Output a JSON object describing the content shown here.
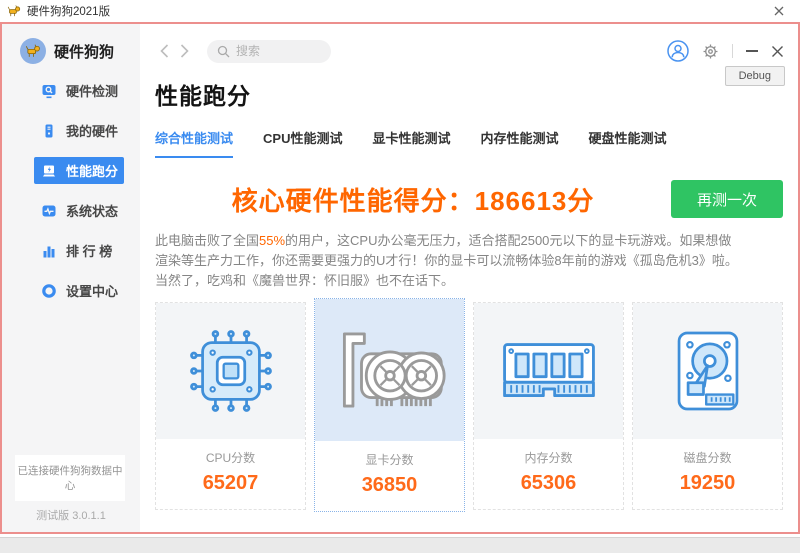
{
  "window": {
    "title": "硬件狗狗2021版"
  },
  "sidebar": {
    "app_name": "硬件狗狗",
    "items": [
      {
        "label": "硬件检测",
        "icon": "monitor-search-icon"
      },
      {
        "label": "我的硬件",
        "icon": "pc-tower-icon"
      },
      {
        "label": "性能跑分",
        "icon": "laptop-bolt-icon"
      },
      {
        "label": "系统状态",
        "icon": "pulse-icon"
      },
      {
        "label": "排 行 榜",
        "icon": "bar-chart-icon"
      },
      {
        "label": "设置中心",
        "icon": "gear-ring-icon"
      }
    ],
    "status": "已连接硬件狗狗数据中心",
    "version": "测试版 3.0.1.1"
  },
  "topbar": {
    "search_placeholder": "搜索"
  },
  "page": {
    "title": "性能跑分",
    "debug_label": "Debug",
    "tabs": [
      {
        "label": "综合性能测试",
        "active": true
      },
      {
        "label": "CPU性能测试",
        "active": false
      },
      {
        "label": "显卡性能测试",
        "active": false
      },
      {
        "label": "内存性能测试",
        "active": false
      },
      {
        "label": "硬盘性能测试",
        "active": false
      }
    ],
    "score_line": "核心硬件性能得分：186613分",
    "retest_label": "再测一次",
    "description": {
      "pre": "此电脑击败了全国",
      "highlight": "55%",
      "post": "的用户，这CPU办公毫无压力，适合搭配2500元以下的显卡玩游戏。如果想做渲染等生产力工作，你还需要更强力的U才行！你的显卡可以流畅体验8年前的游戏《孤岛危机3》啦。当然了，吃鸡和《魔兽世界：怀旧服》也不在话下。"
    }
  },
  "cards": [
    {
      "icon": "cpu-chip-icon",
      "label": "CPU分数",
      "score": "65207",
      "active": false
    },
    {
      "icon": "gpu-card-icon",
      "label": "显卡分数",
      "score": "36850",
      "active": true
    },
    {
      "icon": "ram-stick-icon",
      "label": "内存分数",
      "score": "65306",
      "active": false
    },
    {
      "icon": "hdd-disk-icon",
      "label": "磁盘分数",
      "score": "19250",
      "active": false
    }
  ],
  "colors": {
    "accent_blue": "#3a8bf0",
    "score_orange": "#ff6600",
    "button_green": "#2fc463",
    "window_border_red": "#ec8f8d",
    "sidebar_bg": "#f5f5f6",
    "card_icon_bg": "#f3f5f7",
    "active_card_bg": "#dde9f8"
  }
}
